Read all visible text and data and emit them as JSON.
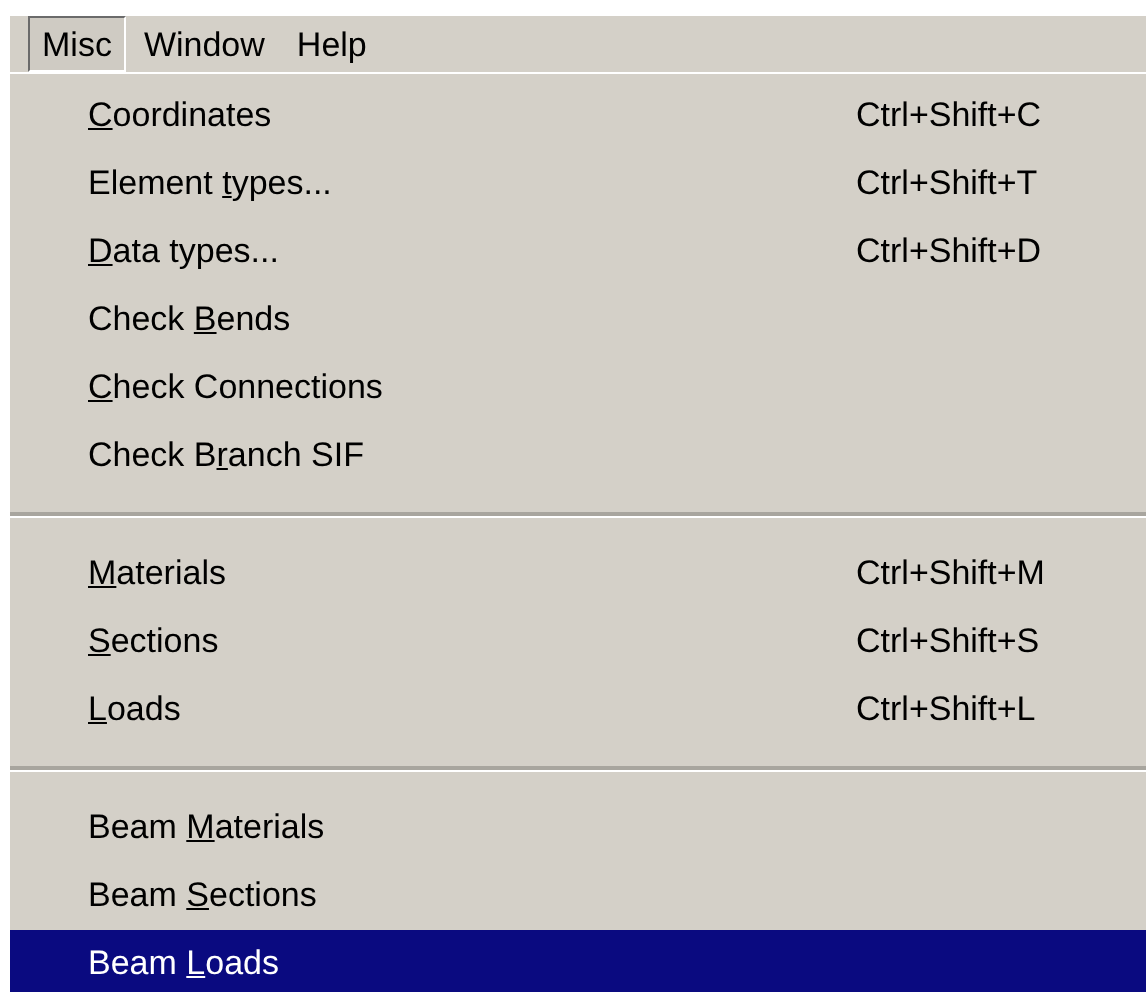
{
  "menu_bar": [
    {
      "label": "Misc",
      "selected": true
    },
    {
      "label": "Window",
      "selected": false
    },
    {
      "label": "Help",
      "selected": false
    }
  ],
  "menu_groups": [
    {
      "items": [
        {
          "key": "C",
          "post": "oordinates",
          "shortcut": "Ctrl+Shift+C",
          "selected": false
        },
        {
          "pre": "Element ",
          "key": "t",
          "post": "ypes...",
          "shortcut": "Ctrl+Shift+T",
          "selected": false
        },
        {
          "key": "D",
          "post": "ata types...",
          "shortcut": "Ctrl+Shift+D",
          "selected": false
        },
        {
          "pre": "Check ",
          "key": "B",
          "post": "ends",
          "selected": false
        },
        {
          "key": "C",
          "post": "heck Connections",
          "selected": false
        },
        {
          "pre": "Check B",
          "key": "r",
          "post": "anch SIF",
          "selected": false
        }
      ]
    },
    {
      "items": [
        {
          "key": "M",
          "post": "aterials",
          "shortcut": "Ctrl+Shift+M",
          "selected": false
        },
        {
          "key": "S",
          "post": "ections",
          "shortcut": "Ctrl+Shift+S",
          "selected": false
        },
        {
          "key": "L",
          "post": "oads",
          "shortcut": "Ctrl+Shift+L",
          "selected": false
        }
      ]
    },
    {
      "items": [
        {
          "pre": "Beam ",
          "key": "M",
          "post": "aterials",
          "selected": false
        },
        {
          "pre": "Beam ",
          "key": "S",
          "post": "ections",
          "selected": false
        },
        {
          "pre": "Beam ",
          "key": "L",
          "post": "oads",
          "selected": true
        }
      ]
    }
  ]
}
